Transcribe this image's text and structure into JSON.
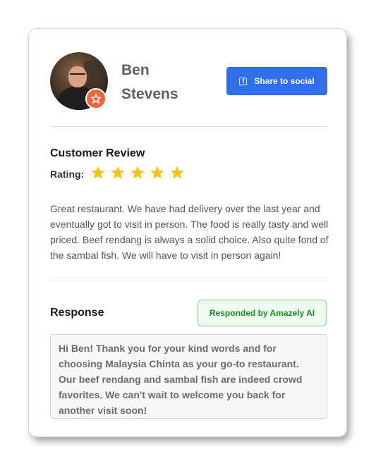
{
  "reviewer": {
    "first_name": "Ben",
    "last_name": "Stevens"
  },
  "share_button": {
    "label": "Share to social",
    "icon": "facebook-icon"
  },
  "review": {
    "title": "Customer Review",
    "rating_label": "Rating:",
    "rating": 5,
    "rating_max": 5,
    "text": "Great restaurant. We have had delivery over the last year and eventually got to visit in person. The food is really tasty and well priced. Beef rendang is always a solid choice. Also quite fond of the sambal fish. We will have to visit in person again!"
  },
  "response": {
    "title": "Response",
    "badge": "Responded by Amazely AI",
    "text": "Hi Ben! Thank you for your kind words and for choosing Malaysia Chinta as your go-to restaurant. Our beef rendang and sambal fish are indeed crowd favorites. We can't wait to welcome you back for another visit soon!"
  },
  "colors": {
    "accent": "#2f6fec",
    "star": "#f5c518",
    "badge_orange": "#f0663a",
    "success_text": "#1f8a2a",
    "success_bg": "#eefcee"
  }
}
